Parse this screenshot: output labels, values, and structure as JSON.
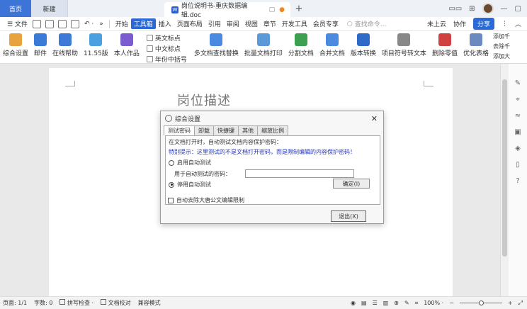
{
  "titlebar": {
    "home_tab": "首页",
    "new_tab": "新建",
    "doc_tab": "岗位说明书-重庆数据编辑.doc",
    "doc_icon": "W",
    "plus": "+",
    "icons": [
      "layout-icon",
      "grid-icon",
      "avatar",
      "minimize-icon",
      "maximize-icon"
    ]
  },
  "menubar": {
    "file": "☰ 文件",
    "items": [
      "开始",
      "工具箱",
      "插入",
      "页面布局",
      "引用",
      "审阅",
      "视图",
      "章节",
      "开发工具",
      "会员专享"
    ],
    "active_item": "工具箱",
    "search_placeholder": "查找命令...",
    "cloud": "未上云",
    "collab": "协作",
    "share": "分享"
  },
  "ribbon": {
    "buttons": [
      {
        "label": "综合设置",
        "color": "#e8a33d"
      },
      {
        "label": "邮件",
        "color": "#3b7ad6"
      },
      {
        "label": "在线帮助",
        "color": "#3b7ad6"
      },
      {
        "label": "11.55版",
        "color": "#4aa0e0"
      },
      {
        "label": "本人作品",
        "color": "#7a5bd0"
      }
    ],
    "stack": [
      "英文标点",
      "中文标点",
      "年份中括号"
    ],
    "buttons2": [
      {
        "label": "多文档查找替换",
        "color": "#4a8ae0"
      },
      {
        "label": "批量文档打印",
        "color": "#5a9ad8"
      },
      {
        "label": "分割文档",
        "color": "#3ca050"
      },
      {
        "label": "合并文档",
        "color": "#4a8ae0"
      },
      {
        "label": "版本转换",
        "color": "#2e6bc8"
      },
      {
        "label": "项目符号转文本",
        "color": "#888888"
      },
      {
        "label": "删除零值",
        "color": "#d04040"
      },
      {
        "label": "优化表格",
        "color": "#6a8ac0"
      }
    ],
    "side_cut": [
      "添加千",
      "去除千",
      "添加大"
    ]
  },
  "document": {
    "title": "岗位描述"
  },
  "dialog": {
    "title": "综合设置",
    "close": "✕",
    "tabs": [
      "测试密码",
      "卸载",
      "快捷键",
      "其他",
      "缩放比例"
    ],
    "selected_tab": "测试密码",
    "line1": "在文档打开时，自动测试文档内容保护密码：",
    "hint": "特别提示：这里测试的不是文档打开密码，而是限制编辑的内容保护密码！",
    "enable_label": "启用自动测试",
    "password_label": "用于自动测试的密码：",
    "password_value": "",
    "disable_label": "停用自动测试",
    "ok_button": "确定(I)",
    "auto_remove_label": "自动去除大唐公文编辑限制",
    "exit_button": "退出(X)"
  },
  "statusbar": {
    "page": "页面: 1/1",
    "words": "字数: 0",
    "spell": "拼写检查 ·",
    "proof": "文档校对",
    "compat": "兼容模式",
    "zoom": "100% ·",
    "minus": "−",
    "plus": "+",
    "zoom_fraction": 0.5
  }
}
